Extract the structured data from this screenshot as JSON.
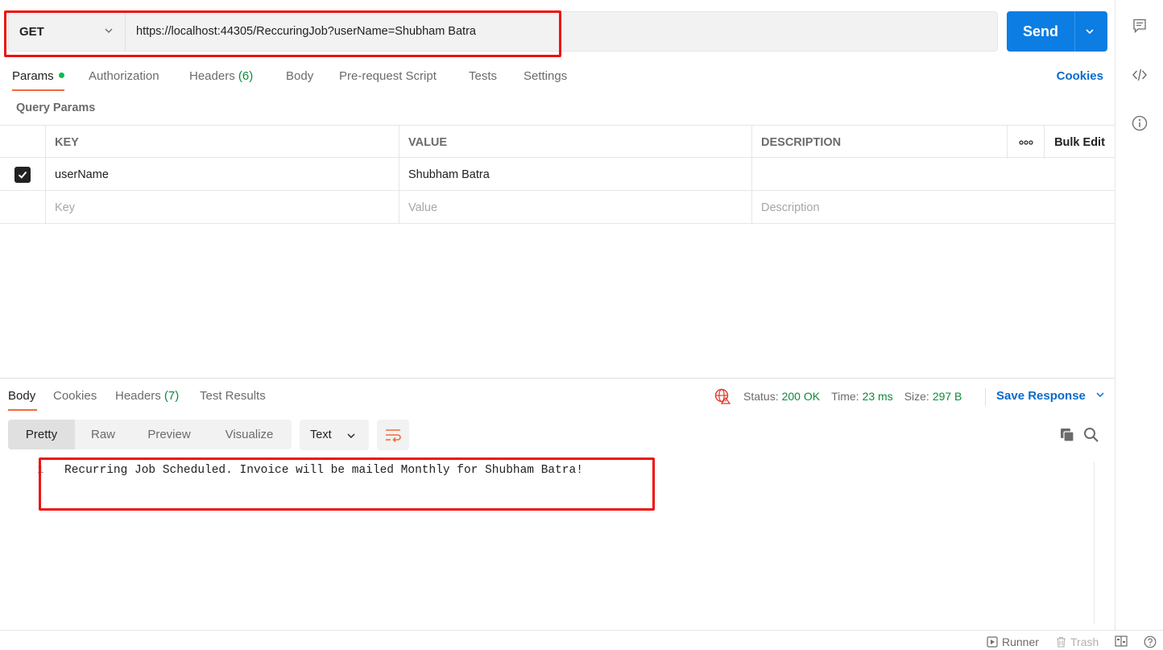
{
  "request": {
    "method": "GET",
    "url": "https://localhost:44305/ReccuringJob?userName=Shubham Batra",
    "send_label": "Send"
  },
  "request_tabs": [
    {
      "label": "Params"
    },
    {
      "label": "Authorization"
    },
    {
      "label": "Headers",
      "count": "(6)"
    },
    {
      "label": "Body"
    },
    {
      "label": "Pre-request Script"
    },
    {
      "label": "Tests"
    },
    {
      "label": "Settings"
    }
  ],
  "cookies_link": "Cookies",
  "query_params": {
    "title": "Query Params",
    "headers": {
      "key": "KEY",
      "value": "VALUE",
      "description": "DESCRIPTION",
      "more": "•••",
      "bulk_edit": "Bulk Edit"
    },
    "rows": [
      {
        "checked": true,
        "key": "userName",
        "value": "Shubham Batra",
        "description": ""
      }
    ],
    "placeholders": {
      "key": "Key",
      "value": "Value",
      "description": "Description"
    }
  },
  "response": {
    "tabs": [
      {
        "label": "Body"
      },
      {
        "label": "Cookies"
      },
      {
        "label": "Headers",
        "count": "(7)"
      },
      {
        "label": "Test Results"
      }
    ],
    "status_label": "Status:",
    "status_value": "200 OK",
    "time_label": "Time:",
    "time_value": "23 ms",
    "size_label": "Size:",
    "size_value": "297 B",
    "save_response": "Save Response",
    "formats": [
      "Pretty",
      "Raw",
      "Preview",
      "Visualize"
    ],
    "selected_format": "Pretty",
    "language": "Text",
    "line_number": "1",
    "body_line": "Recurring Job Scheduled. Invoice will be mailed Monthly for Shubham Batra!"
  },
  "footer": {
    "runner": "Runner",
    "trash": "Trash"
  },
  "colors": {
    "accent": "#0b7de3",
    "active_tab": "#f26b3a",
    "success": "#0c8a3a",
    "highlight": "#ee1111"
  }
}
